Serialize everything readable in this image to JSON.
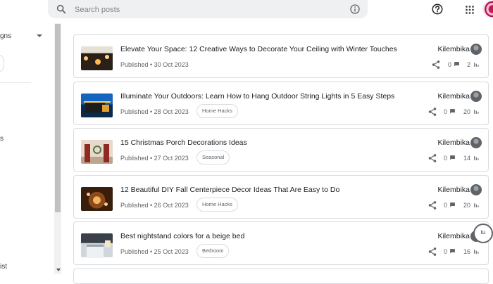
{
  "search": {
    "placeholder": "Search posts"
  },
  "sidebar": {
    "item_top": "gns",
    "item_mid": "s",
    "item_bottom": "ist"
  },
  "posts": [
    {
      "title": "Elevate Your Space: 12 Creative Ways to Decorate Your Ceiling with Winter Touches",
      "published": "Published • 30 Oct 2023",
      "label": "",
      "author": "Kilembika",
      "comments": "0",
      "views": "2"
    },
    {
      "title": "Illuminate Your Outdoors: Learn How to Hang Outdoor String Lights in 5 Easy Steps",
      "published": "Published • 28 Oct 2023",
      "label": "Home Hacks",
      "author": "Kilembika",
      "comments": "0",
      "views": "20"
    },
    {
      "title": "15 Christmas Porch Decorations Ideas",
      "published": "Published • 27 Oct 2023",
      "label": "Seasonal",
      "author": "Kilembika",
      "comments": "0",
      "views": "14"
    },
    {
      "title": "12 Beautiful DIY Fall Centerpiece Decor Ideas That Are Easy to Do",
      "published": "Published • 26 Oct 2023",
      "label": "Home Hacks",
      "author": "Kilembika",
      "comments": "0",
      "views": "20"
    },
    {
      "title": "Best nightstand colors for a beige bed",
      "published": "Published • 25 Oct 2023",
      "label": "Bedroom",
      "author": "Kilembika",
      "comments": "0",
      "views": "16"
    }
  ],
  "fab": {
    "text": "tu"
  },
  "colors": {
    "accent": "#1a73e8",
    "border": "#dadce0",
    "muted": "#5f6368"
  },
  "icons": [
    "search-icon",
    "info-icon",
    "help-icon",
    "apps-grid-icon",
    "share-icon",
    "comment-icon",
    "views-bar-icon"
  ]
}
